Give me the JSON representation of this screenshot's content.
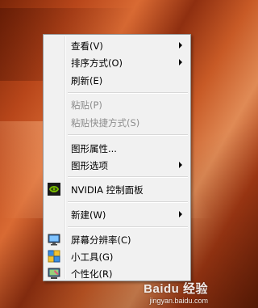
{
  "context_menu": {
    "items": [
      {
        "label": "查看(V)",
        "has_submenu": true
      },
      {
        "label": "排序方式(O)",
        "has_submenu": true
      },
      {
        "label": "刷新(E)"
      },
      {
        "label": "粘贴(P)",
        "disabled": true
      },
      {
        "label": "粘贴快捷方式(S)",
        "disabled": true
      },
      {
        "label": "图形属性..."
      },
      {
        "label": "图形选项",
        "has_submenu": true
      },
      {
        "label": "NVIDIA 控制面板",
        "icon": "nvidia-icon"
      },
      {
        "label": "新建(W)",
        "has_submenu": true
      },
      {
        "label": "屏幕分辨率(C)",
        "icon": "monitor-icon"
      },
      {
        "label": "小工具(G)",
        "icon": "gadgets-icon"
      },
      {
        "label": "个性化(R)",
        "icon": "personalize-icon"
      }
    ]
  },
  "watermark": {
    "brand": "Baidu 经验",
    "url": "jingyan.baidu.com"
  },
  "colors": {
    "menu_background": "#f1f1f1",
    "disabled_text": "#8d8d8d",
    "nvidia_green": "#76b900"
  }
}
